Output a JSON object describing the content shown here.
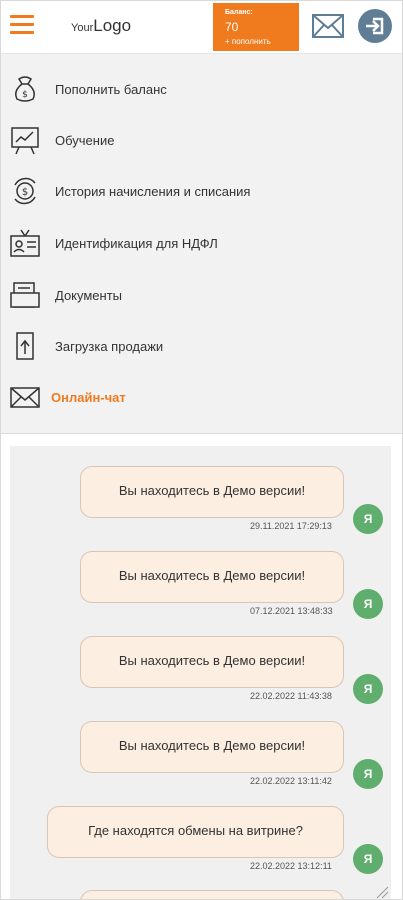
{
  "header": {
    "logo_your": "Your",
    "logo_mark": "Logo",
    "balance_label": "Баланс:",
    "balance_value": "70",
    "topup_label": "+ пополнить"
  },
  "menu": {
    "items": [
      {
        "label": "Пополнить баланс",
        "icon": "money-bag-icon"
      },
      {
        "label": "Обучение",
        "icon": "presentation-board-icon"
      },
      {
        "label": "История начисления и списания",
        "icon": "dollar-cycle-icon"
      },
      {
        "label": "Идентификация для НДФЛ",
        "icon": "id-card-icon"
      },
      {
        "label": "Документы",
        "icon": "documents-icon"
      },
      {
        "label": "Загрузка продажи",
        "icon": "upload-document-icon"
      },
      {
        "label": "Онлайн-чат",
        "icon": "envelope-icon"
      }
    ]
  },
  "chat": {
    "messages": [
      {
        "text": "Вы находитесь в Демо версии!",
        "time": "29.11.2021 17:29:13",
        "avatar": "Я"
      },
      {
        "text": "Вы находитесь в Демо версии!",
        "time": "07.12.2021 13:48:33",
        "avatar": "Я"
      },
      {
        "text": "Вы находитесь в Демо версии!",
        "time": "22.02.2022 11:43:38",
        "avatar": "Я"
      },
      {
        "text": "Вы находитесь в Демо версии!",
        "time": "22.02.2022 13:11:42",
        "avatar": "Я"
      },
      {
        "text": "Где находятся обмены на витрине?",
        "time": "22.02.2022 13:12:11",
        "avatar": "Я"
      }
    ]
  },
  "colors": {
    "accent": "#f07a1e",
    "avatar": "#5fae6e",
    "bubble": "#fdeee2",
    "login": "#5f7d95"
  }
}
